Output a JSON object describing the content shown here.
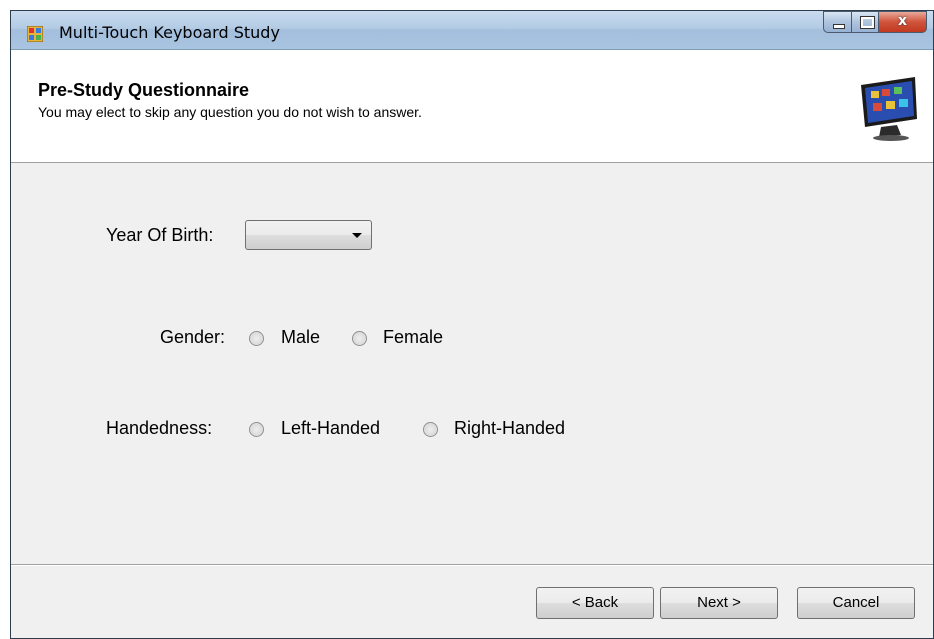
{
  "window": {
    "title": "Multi-Touch Keyboard Study",
    "close_glyph": "x"
  },
  "header": {
    "title": "Pre-Study Questionnaire",
    "subtitle": "You may elect to skip any question you do not wish to answer.",
    "image": "touch-monitor-icon"
  },
  "form": {
    "year_label": "Year Of Birth:",
    "year_value": "",
    "gender_label": "Gender:",
    "gender_options": [
      "Male",
      "Female"
    ],
    "handedness_label": "Handedness:",
    "handedness_options": [
      "Left-Handed",
      "Right-Handed"
    ]
  },
  "buttons": {
    "back": "< Back",
    "next": "Next >",
    "cancel": "Cancel"
  },
  "colors": {
    "titlebar": "#b3cbe4",
    "close": "#c0391f",
    "body": "#f0f0f0"
  }
}
